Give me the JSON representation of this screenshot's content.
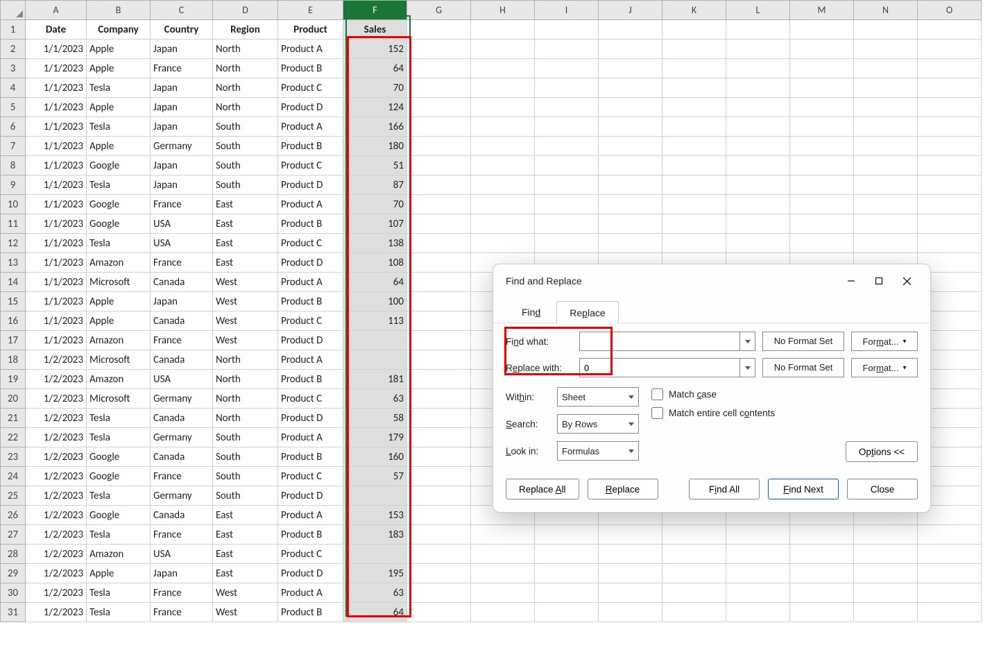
{
  "columns": [
    "A",
    "B",
    "C",
    "D",
    "E",
    "F",
    "G",
    "H",
    "I",
    "J",
    "K",
    "L",
    "M",
    "N",
    "O"
  ],
  "headers": [
    "Date",
    "Company",
    "Country",
    "Region",
    "Product",
    "Sales"
  ],
  "rows": [
    [
      "1/1/2023",
      "Apple",
      "Japan",
      "North",
      "Product A",
      "152"
    ],
    [
      "1/1/2023",
      "Apple",
      "France",
      "North",
      "Product B",
      "64"
    ],
    [
      "1/1/2023",
      "Tesla",
      "Japan",
      "North",
      "Product C",
      "70"
    ],
    [
      "1/1/2023",
      "Apple",
      "Japan",
      "North",
      "Product D",
      "124"
    ],
    [
      "1/1/2023",
      "Tesla",
      "Japan",
      "South",
      "Product A",
      "166"
    ],
    [
      "1/1/2023",
      "Apple",
      "Germany",
      "South",
      "Product B",
      "180"
    ],
    [
      "1/1/2023",
      "Google",
      "Japan",
      "South",
      "Product C",
      "51"
    ],
    [
      "1/1/2023",
      "Tesla",
      "Japan",
      "South",
      "Product D",
      "87"
    ],
    [
      "1/1/2023",
      "Google",
      "France",
      "East",
      "Product A",
      "70"
    ],
    [
      "1/1/2023",
      "Google",
      "USA",
      "East",
      "Product B",
      "107"
    ],
    [
      "1/1/2023",
      "Tesla",
      "USA",
      "East",
      "Product C",
      "138"
    ],
    [
      "1/1/2023",
      "Amazon",
      "France",
      "East",
      "Product D",
      "108"
    ],
    [
      "1/1/2023",
      "Microsoft",
      "Canada",
      "West",
      "Product A",
      "64"
    ],
    [
      "1/1/2023",
      "Apple",
      "Japan",
      "West",
      "Product B",
      "100"
    ],
    [
      "1/1/2023",
      "Apple",
      "Canada",
      "West",
      "Product C",
      "113"
    ],
    [
      "1/1/2023",
      "Amazon",
      "France",
      "West",
      "Product D",
      ""
    ],
    [
      "1/2/2023",
      "Microsoft",
      "Canada",
      "North",
      "Product A",
      ""
    ],
    [
      "1/2/2023",
      "Amazon",
      "USA",
      "North",
      "Product B",
      "181"
    ],
    [
      "1/2/2023",
      "Microsoft",
      "Germany",
      "North",
      "Product C",
      "63"
    ],
    [
      "1/2/2023",
      "Tesla",
      "Canada",
      "North",
      "Product D",
      "58"
    ],
    [
      "1/2/2023",
      "Tesla",
      "Germany",
      "South",
      "Product A",
      "179"
    ],
    [
      "1/2/2023",
      "Google",
      "Canada",
      "South",
      "Product B",
      "160"
    ],
    [
      "1/2/2023",
      "Google",
      "France",
      "South",
      "Product C",
      "57"
    ],
    [
      "1/2/2023",
      "Tesla",
      "Germany",
      "South",
      "Product D",
      ""
    ],
    [
      "1/2/2023",
      "Google",
      "Canada",
      "East",
      "Product A",
      "153"
    ],
    [
      "1/2/2023",
      "Tesla",
      "France",
      "East",
      "Product B",
      "183"
    ],
    [
      "1/2/2023",
      "Amazon",
      "USA",
      "East",
      "Product C",
      ""
    ],
    [
      "1/2/2023",
      "Apple",
      "Japan",
      "East",
      "Product D",
      "195"
    ],
    [
      "1/2/2023",
      "Tesla",
      "France",
      "West",
      "Product A",
      "63"
    ],
    [
      "1/2/2023",
      "Tesla",
      "France",
      "West",
      "Product B",
      "64"
    ]
  ],
  "selectedColumn": "F",
  "dialog": {
    "title": "Find and Replace",
    "tabs": {
      "find": "Find",
      "replace": "Replace",
      "active": "replace"
    },
    "findWhatLabel": "Find what:",
    "replaceWithLabel": "Replace with:",
    "findWhatValue": "",
    "replaceWithValue": "0",
    "noFormatSet": "No Format Set",
    "formatBtn": "Format...",
    "withinLabel": "Within:",
    "withinValue": "Sheet",
    "searchLabel": "Search:",
    "searchValue": "By Rows",
    "lookInLabel": "Look in:",
    "lookInValue": "Formulas",
    "matchCase": "Match case",
    "matchEntire": "Match entire cell contents",
    "optionsBtn": "Options <<",
    "replaceAllBtn": "Replace All",
    "replaceBtn": "Replace",
    "findAllBtn": "Find All",
    "findNextBtn": "Find Next",
    "closeBtn": "Close"
  }
}
